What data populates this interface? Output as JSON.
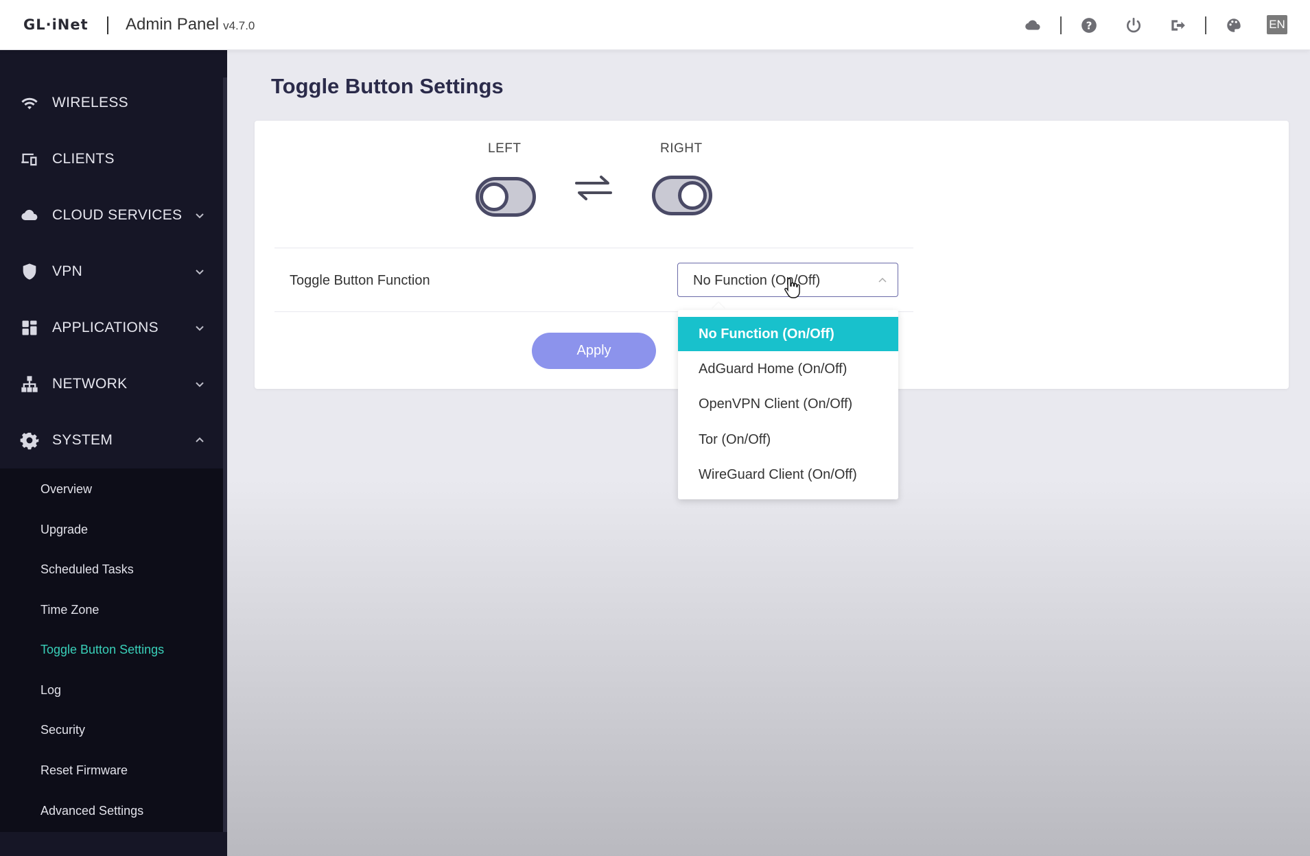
{
  "header": {
    "logo": "GL·iNet",
    "title": "Admin Panel",
    "version": "v4.7.0",
    "icons": [
      "cloud-icon",
      "help-icon",
      "power-icon",
      "logout-icon",
      "palette-icon"
    ],
    "language": "EN"
  },
  "sidebar": {
    "items": [
      {
        "label": "WIRELESS",
        "icon": "wifi-icon",
        "expandable": false
      },
      {
        "label": "CLIENTS",
        "icon": "devices-icon",
        "expandable": false
      },
      {
        "label": "CLOUD SERVICES",
        "icon": "cloud-icon",
        "expandable": true
      },
      {
        "label": "VPN",
        "icon": "shield-icon",
        "expandable": true
      },
      {
        "label": "APPLICATIONS",
        "icon": "grid-icon",
        "expandable": true
      },
      {
        "label": "NETWORK",
        "icon": "network-icon",
        "expandable": true
      },
      {
        "label": "SYSTEM",
        "icon": "gear-icon",
        "expandable": true,
        "expanded": true
      }
    ],
    "system_sub": [
      "Overview",
      "Upgrade",
      "Scheduled Tasks",
      "Time Zone",
      "Toggle Button Settings",
      "Log",
      "Security",
      "Reset Firmware",
      "Advanced Settings"
    ],
    "active_sub": "Toggle Button Settings"
  },
  "main": {
    "page_title": "Toggle Button Settings",
    "left_label": "LEFT",
    "right_label": "RIGHT",
    "function_label": "Toggle Button Function",
    "selected_value": "No Function (On/Off)",
    "apply_label": "Apply",
    "options": [
      "No Function (On/Off)",
      "AdGuard Home (On/Off)",
      "OpenVPN Client (On/Off)",
      "Tor (On/Off)",
      "WireGuard Client (On/Off)"
    ]
  },
  "colors": {
    "sidebar_bg": "#161626",
    "active_green": "#39d0b9",
    "selected_option": "#18c1cc",
    "apply_button": "#8c93ec"
  }
}
